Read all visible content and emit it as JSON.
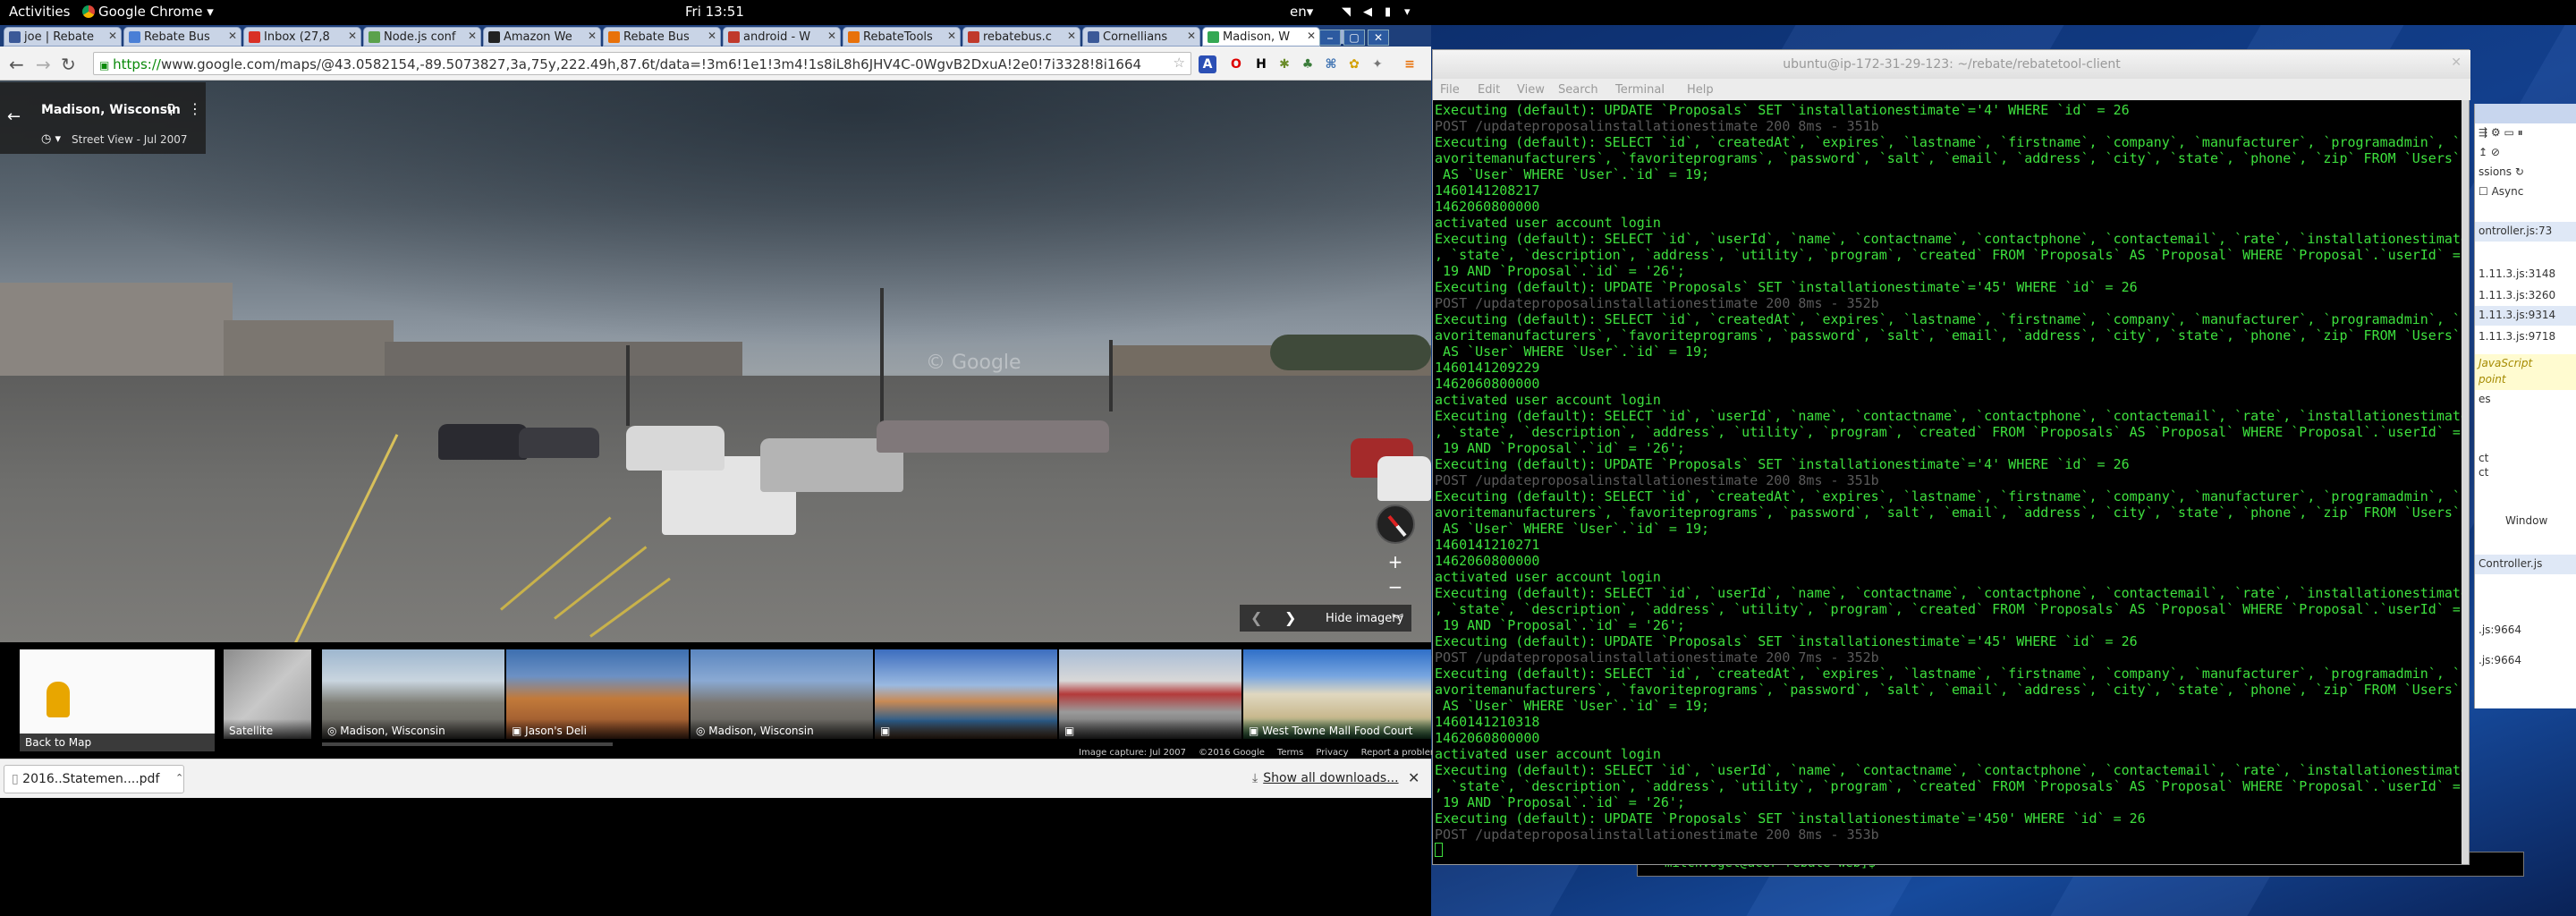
{
  "topbar": {
    "activities": "Activities",
    "app_menu": "Google Chrome ▾",
    "clock": "Fri 13:51",
    "lang": "en▾"
  },
  "tabs": [
    {
      "label": "joe | Rebate",
      "color": "#3b5998"
    },
    {
      "label": "Rebate Bus",
      "color": "#4a7fd6"
    },
    {
      "label": "Inbox (27,8",
      "color": "#d93025"
    },
    {
      "label": "Node.js conf",
      "color": "#5aa14b"
    },
    {
      "label": "Amazon We",
      "color": "#222222"
    },
    {
      "label": "Rebate Bus",
      "color": "#e8710a"
    },
    {
      "label": "android - W",
      "color": "#c0392b"
    },
    {
      "label": "RebateTools",
      "color": "#e8710a"
    },
    {
      "label": "rebatebus.c",
      "color": "#c0392b"
    },
    {
      "label": "Cornellians",
      "color": "#3b5998"
    },
    {
      "label": "Madison, W",
      "color": "#34a853"
    }
  ],
  "window_buttons": [
    "⎯",
    "▢",
    "✕"
  ],
  "address_bar": {
    "scheme": "https://",
    "url": "www.google.com/maps/@43.0582154,-89.5073827,3a,75y,222.49h,87.6t/data=!3m6!1e1!3m4!1s8iL8h6JHV4C-0WgvB2DxuA!2e0!7i3328!8i1664"
  },
  "maps": {
    "place_title": "Madison, Wisconsin",
    "street_view_label": "Street View - Jul 2007",
    "hide_imagery": "Hide imagery",
    "back_to_map": "Back to Map",
    "watermark": "© Google",
    "thumbnails": [
      {
        "label": "Satellite",
        "icon": ""
      },
      {
        "label": "Madison, Wisconsin",
        "icon": "360-icon"
      },
      {
        "label": "Jason's Deli",
        "icon": "camera-icon"
      },
      {
        "label": "Madison, Wisconsin",
        "icon": "360-icon"
      },
      {
        "label": "",
        "icon": "camera-icon"
      },
      {
        "label": "",
        "icon": "camera-icon"
      },
      {
        "label": "West Towne Mall Food Court",
        "icon": "camera-icon"
      }
    ],
    "credits": [
      "Image capture: Jul 2007",
      "©2016 Google",
      "Terms",
      "Privacy",
      "Report a problem"
    ]
  },
  "downloads": {
    "file": "2016..Statemen....pdf",
    "show_all": "Show all downloads..."
  },
  "terminal": {
    "title": "ubuntu@ip-172-31-29-123: ~/rebate/rebatetool-client",
    "menu": [
      "File",
      "Edit",
      "View",
      "Search",
      "Terminal",
      "Help"
    ],
    "lines": [
      {
        "t": "Executing (default): UPDATE `Proposals` SET `installationestimate`='4' WHERE `id` = 26",
        "dim": false
      },
      {
        "t": "POST /updateproposalinstallationestimate 200 8ms - 351b",
        "dim": true
      },
      {
        "t": "Executing (default): SELECT `id`, `createdAt`, `expires`, `lastname`, `firstname`, `company`, `manufacturer`, `programadmin`, `f",
        "dim": false
      },
      {
        "t": "avoritemanufacturers`, `favoriteprograms`, `password`, `salt`, `email`, `address`, `city`, `state`, `phone`, `zip` FROM `Users`",
        "dim": false
      },
      {
        "t": " AS `User` WHERE `User`.`id` = 19;",
        "dim": false
      },
      {
        "t": "1460141208217",
        "dim": false
      },
      {
        "t": "1462060800000",
        "dim": false
      },
      {
        "t": "activated user account login",
        "dim": false
      },
      {
        "t": "Executing (default): SELECT `id`, `userId`, `name`, `contactname`, `contactphone`, `contactemail`, `rate`, `installationestimate`",
        "dim": false
      },
      {
        "t": ", `state`, `description`, `address`, `utility`, `program`, `created` FROM `Proposals` AS `Proposal` WHERE `Proposal`.`userId` =",
        "dim": false
      },
      {
        "t": " 19 AND `Proposal`.`id` = '26';",
        "dim": false
      },
      {
        "t": "Executing (default): UPDATE `Proposals` SET `installationestimate`='45' WHERE `id` = 26",
        "dim": false
      },
      {
        "t": "POST /updateproposalinstallationestimate 200 8ms - 352b",
        "dim": true
      },
      {
        "t": "Executing (default): SELECT `id`, `createdAt`, `expires`, `lastname`, `firstname`, `company`, `manufacturer`, `programadmin`, `f",
        "dim": false
      },
      {
        "t": "avoritemanufacturers`, `favoriteprograms`, `password`, `salt`, `email`, `address`, `city`, `state`, `phone`, `zip` FROM `Users`",
        "dim": false
      },
      {
        "t": " AS `User` WHERE `User`.`id` = 19;",
        "dim": false
      },
      {
        "t": "1460141209229",
        "dim": false
      },
      {
        "t": "1462060800000",
        "dim": false
      },
      {
        "t": "activated user account login",
        "dim": false
      },
      {
        "t": "Executing (default): SELECT `id`, `userId`, `name`, `contactname`, `contactphone`, `contactemail`, `rate`, `installationestimate`",
        "dim": false
      },
      {
        "t": ", `state`, `description`, `address`, `utility`, `program`, `created` FROM `Proposals` AS `Proposal` WHERE `Proposal`.`userId` =",
        "dim": false
      },
      {
        "t": " 19 AND `Proposal`.`id` = '26';",
        "dim": false
      },
      {
        "t": "Executing (default): UPDATE `Proposals` SET `installationestimate`='4' WHERE `id` = 26",
        "dim": false
      },
      {
        "t": "POST /updateproposalinstallationestimate 200 8ms - 351b",
        "dim": true
      },
      {
        "t": "Executing (default): SELECT `id`, `createdAt`, `expires`, `lastname`, `firstname`, `company`, `manufacturer`, `programadmin`, `f",
        "dim": false
      },
      {
        "t": "avoritemanufacturers`, `favoriteprograms`, `password`, `salt`, `email`, `address`, `city`, `state`, `phone`, `zip` FROM `Users`",
        "dim": false
      },
      {
        "t": " AS `User` WHERE `User`.`id` = 19;",
        "dim": false
      },
      {
        "t": "1460141210271",
        "dim": false
      },
      {
        "t": "1462060800000",
        "dim": false
      },
      {
        "t": "activated user account login",
        "dim": false
      },
      {
        "t": "Executing (default): SELECT `id`, `userId`, `name`, `contactname`, `contactphone`, `contactemail`, `rate`, `installationestimate`",
        "dim": false
      },
      {
        "t": ", `state`, `description`, `address`, `utility`, `program`, `created` FROM `Proposals` AS `Proposal` WHERE `Proposal`.`userId` =",
        "dim": false
      },
      {
        "t": " 19 AND `Proposal`.`id` = '26';",
        "dim": false
      },
      {
        "t": "Executing (default): UPDATE `Proposals` SET `installationestimate`='45' WHERE `id` = 26",
        "dim": false
      },
      {
        "t": "POST /updateproposalinstallationestimate 200 7ms - 352b",
        "dim": true
      },
      {
        "t": "Executing (default): SELECT `id`, `createdAt`, `expires`, `lastname`, `firstname`, `company`, `manufacturer`, `programadmin`, `f",
        "dim": false
      },
      {
        "t": "avoritemanufacturers`, `favoriteprograms`, `password`, `salt`, `email`, `address`, `city`, `state`, `phone`, `zip` FROM `Users`",
        "dim": false
      },
      {
        "t": " AS `User` WHERE `User`.`id` = 19;",
        "dim": false
      },
      {
        "t": "1460141210318",
        "dim": false
      },
      {
        "t": "1462060800000",
        "dim": false
      },
      {
        "t": "activated user account login",
        "dim": false
      },
      {
        "t": "Executing (default): SELECT `id`, `userId`, `name`, `contactname`, `contactphone`, `contactemail`, `rate`, `installationestimate`",
        "dim": false
      },
      {
        "t": ", `state`, `description`, `address`, `utility`, `program`, `created` FROM `Proposals` AS `Proposal` WHERE `Proposal`.`userId` =",
        "dim": false
      },
      {
        "t": " 19 AND `Proposal`.`id` = '26';",
        "dim": false
      },
      {
        "t": "Executing (default): UPDATE `Proposals` SET `installationestimate`='450' WHERE `id` = 26",
        "dim": false
      },
      {
        "t": "POST /updateproposalinstallationestimate 200 8ms - 353b",
        "dim": true
      }
    ]
  },
  "devtools": {
    "rows": [
      "ontroller.js:73",
      "1.11.3.js:3148",
      "1.11.3.js:3260",
      "1.11.3.js:9314",
      "1.11.3.js:9718",
      "JavaScript",
      "point",
      "es",
      "ct",
      "ct",
      "Window",
      "Controller.js",
      ".js:9664",
      ".js:9664"
    ],
    "async_label": "Async",
    "sessions_label": "ssions"
  },
  "bottom_prompt": "mitchvogel@acer rebate-web]$"
}
